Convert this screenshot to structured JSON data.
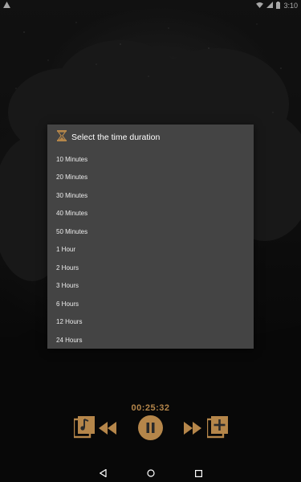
{
  "status_bar": {
    "time": "3:10"
  },
  "dialog": {
    "title": "Select the time duration",
    "options": [
      "10 Minutes",
      "20 Minutes",
      "30 Minutes",
      "40 Minutes",
      "50 Minutes",
      "1 Hour",
      "2 Hours",
      "3 Hours",
      "6 Hours",
      "12 Hours",
      "24 Hours"
    ]
  },
  "player": {
    "elapsed": "00:25:32"
  },
  "colors": {
    "accent": "#b5864a",
    "dialog_bg": "#444444",
    "scrim": "#000000"
  },
  "icons": {
    "status_left": "warning-icon",
    "status_right": [
      "wifi-icon",
      "signal-icon",
      "battery-icon"
    ],
    "dialog": "hourglass-icon",
    "controls": [
      "music-library-icon",
      "rewind-icon",
      "pause-icon",
      "fast-forward-icon",
      "add-playlist-icon"
    ],
    "nav": [
      "back-icon",
      "home-icon",
      "recents-icon"
    ]
  }
}
